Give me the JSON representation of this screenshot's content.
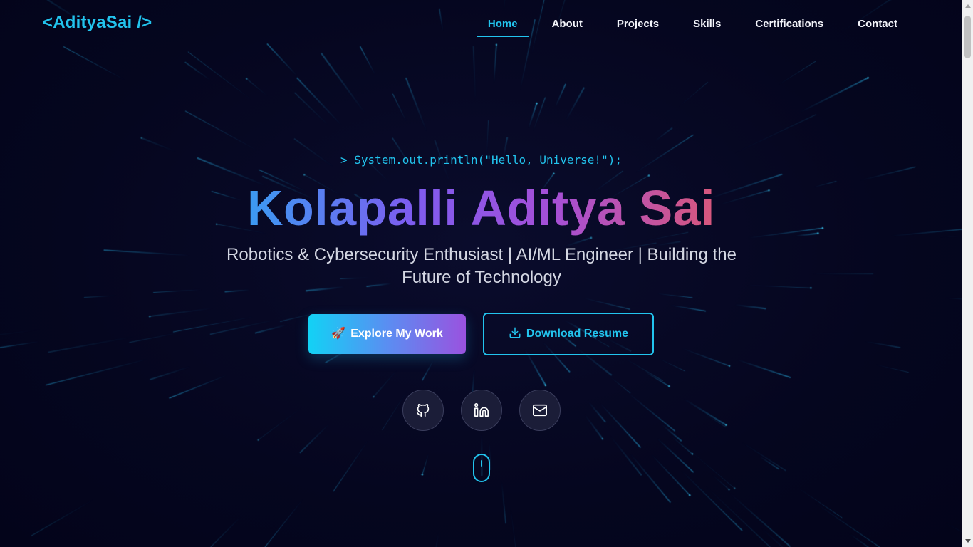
{
  "logo": {
    "text": "<AdityaSai />"
  },
  "nav": {
    "items": [
      {
        "label": "Home",
        "active": true
      },
      {
        "label": "About",
        "active": false
      },
      {
        "label": "Projects",
        "active": false
      },
      {
        "label": "Skills",
        "active": false
      },
      {
        "label": "Certifications",
        "active": false
      },
      {
        "label": "Contact",
        "active": false
      }
    ]
  },
  "hero": {
    "code_line": "> System.out.println(\"Hello, Universe!\");",
    "name": "Kolapalli Aditya Sai",
    "tagline": "Robotics & Cybersecurity Enthusiast | AI/ML Engineer | Building the Future of Technology",
    "primary_button": {
      "icon": "🚀",
      "label": "Explore My Work"
    },
    "secondary_button": {
      "icon": "download-icon",
      "label": "Download Resume"
    },
    "social": [
      {
        "icon": "github-icon"
      },
      {
        "icon": "linkedin-icon"
      },
      {
        "icon": "mail-icon"
      }
    ]
  },
  "colors": {
    "background": "#05061f",
    "accent": "#22c4ee",
    "gradient_start": "#3b9bf2",
    "gradient_mid": "#a54fd7",
    "gradient_end": "#d8577c"
  }
}
